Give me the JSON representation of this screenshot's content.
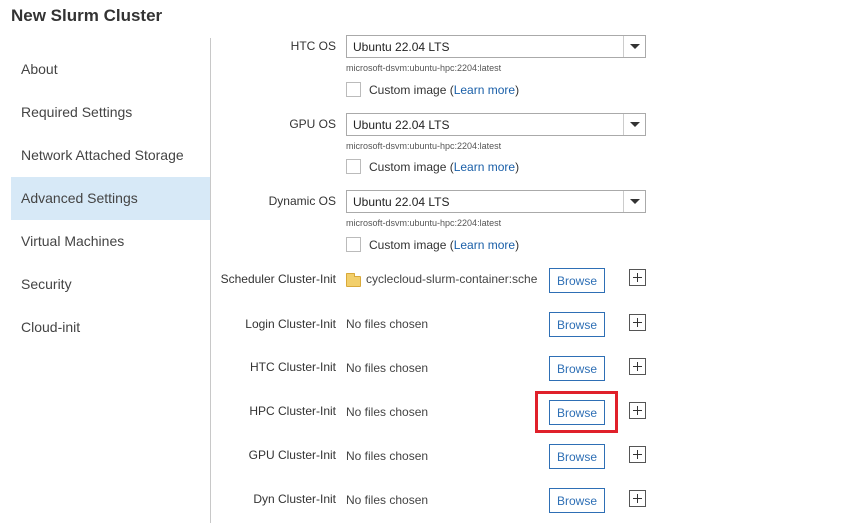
{
  "app": {
    "title": "New Slurm Cluster"
  },
  "sidebar": {
    "items": [
      {
        "label": "About"
      },
      {
        "label": "Required Settings"
      },
      {
        "label": "Network Attached Storage"
      },
      {
        "label": "Advanced Settings"
      },
      {
        "label": "Virtual Machines"
      },
      {
        "label": "Security"
      },
      {
        "label": "Cloud-init"
      }
    ],
    "active_index": 3
  },
  "os": [
    {
      "label": "HTC OS",
      "value": "Ubuntu 22.04 LTS",
      "hint": "microsoft-dsvm:ubuntu-hpc:2204:latest",
      "custom_label": "Custom image (",
      "learn_more": "Learn more",
      "custom_suffix": ")"
    },
    {
      "label": "GPU OS",
      "value": "Ubuntu 22.04 LTS",
      "hint": "microsoft-dsvm:ubuntu-hpc:2204:latest",
      "custom_label": "Custom image (",
      "learn_more": "Learn more",
      "custom_suffix": ")"
    },
    {
      "label": "Dynamic OS",
      "value": "Ubuntu 22.04 LTS",
      "hint": "microsoft-dsvm:ubuntu-hpc:2204:latest",
      "custom_label": "Custom image (",
      "learn_more": "Learn more",
      "custom_suffix": ")"
    }
  ],
  "cluster_init": [
    {
      "label": "Scheduler Cluster-Init",
      "files": "cyclecloud-slurm-container:sche",
      "has_folder": true,
      "browse": "Browse"
    },
    {
      "label": "Login Cluster-Init",
      "files": "No files chosen",
      "has_folder": false,
      "browse": "Browse"
    },
    {
      "label": "HTC Cluster-Init",
      "files": "No files chosen",
      "has_folder": false,
      "browse": "Browse"
    },
    {
      "label": "HPC Cluster-Init",
      "files": "No files chosen",
      "has_folder": false,
      "browse": "Browse"
    },
    {
      "label": "GPU Cluster-Init",
      "files": "No files chosen",
      "has_folder": false,
      "browse": "Browse"
    },
    {
      "label": "Dyn Cluster-Init",
      "files": "No files chosen",
      "has_folder": false,
      "browse": "Browse"
    }
  ],
  "highlight_color": "#e0202a",
  "accent_color": "#2e6fb5"
}
